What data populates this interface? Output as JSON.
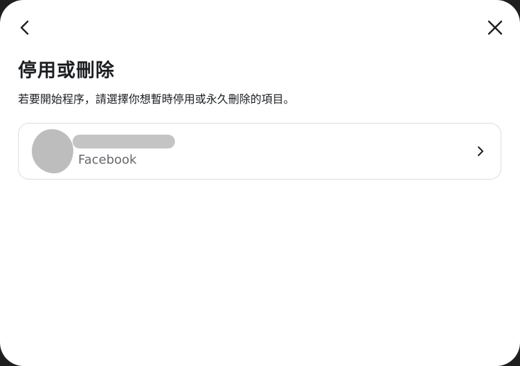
{
  "dialog": {
    "title": "停用或刪除",
    "subtitle": "若要開始程序，請選擇你想暫時停用或永久刪除的項目。",
    "icons": {
      "back": "chevron-left-icon",
      "close": "close-icon",
      "chevron": "chevron-right-icon"
    }
  },
  "account": {
    "platform": "Facebook"
  }
}
